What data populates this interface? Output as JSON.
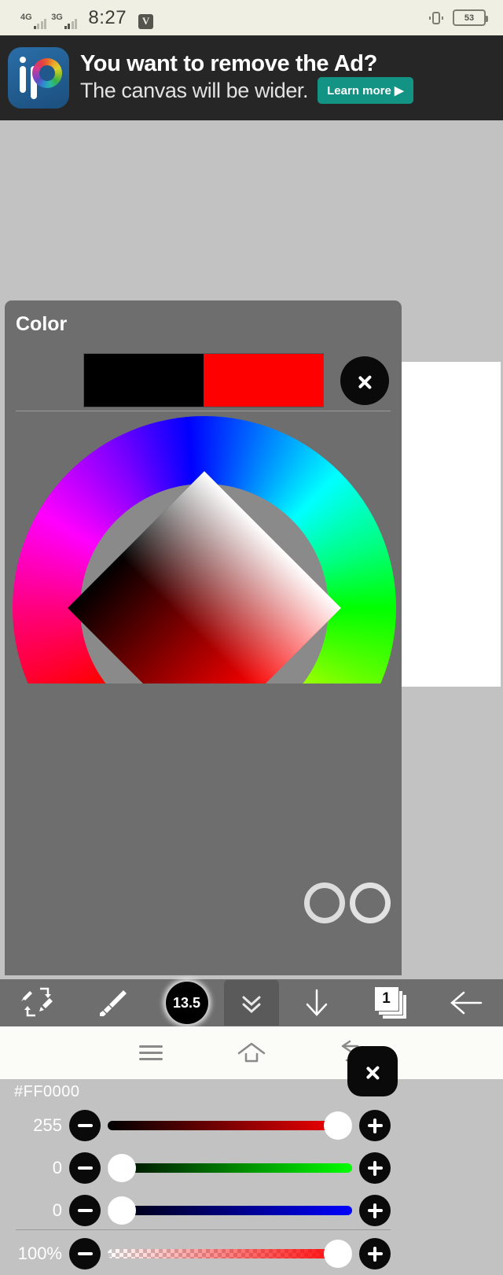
{
  "status_bar": {
    "network_4g": "4G",
    "network_3g": "3G",
    "time": "8:27",
    "vpn_badge": "V",
    "battery_level": "53",
    "vibrate_icon": "vibrate-icon"
  },
  "ad": {
    "headline": "You want to remove the Ad?",
    "subline": "The canvas will be wider.",
    "cta_label": "Learn more ▶",
    "cta_color": "#139383",
    "background": "#262626",
    "logo_name": "ibis-paint-logo"
  },
  "color_panel": {
    "title": "Color",
    "hex_value": "#FF0000",
    "swatch_primary": "#000000",
    "swatch_secondary": "#FF0000",
    "next_button_icon": "chevron-right-icon",
    "wheel_next_button_icon": "chevron-right-icon",
    "sliders": [
      {
        "name": "red",
        "value": "255",
        "percent": 100,
        "track_from": "#000000",
        "track_to": "#FF0000",
        "minus": "−",
        "plus": "+"
      },
      {
        "name": "green",
        "value": "0",
        "percent": 0,
        "track_from": "#000000",
        "track_to": "#00FF00",
        "minus": "−",
        "plus": "+"
      },
      {
        "name": "blue",
        "value": "0",
        "percent": 0,
        "track_from": "#000000",
        "track_to": "#0000FF",
        "minus": "−",
        "plus": "+"
      },
      {
        "name": "alpha",
        "value": "100%",
        "percent": 100,
        "track_from": "transparent",
        "track_to": "#FF0000",
        "minus": "−",
        "plus": "+"
      }
    ]
  },
  "toolbar": {
    "items": [
      {
        "name": "brush-eraser-swap",
        "label": ""
      },
      {
        "name": "brush-tool",
        "label": ""
      },
      {
        "name": "brush-size",
        "label": "13.5"
      },
      {
        "name": "collapse-panel",
        "label": ""
      },
      {
        "name": "download-tool",
        "label": ""
      },
      {
        "name": "layers",
        "label": "1"
      },
      {
        "name": "back-tool",
        "label": ""
      }
    ]
  },
  "nav_bar": {
    "menu_icon": "menu-icon",
    "home_icon": "home-icon",
    "back_icon": "back-icon"
  },
  "canvas": {
    "background": "#c2c2c2",
    "paper_color": "#ffffff"
  }
}
